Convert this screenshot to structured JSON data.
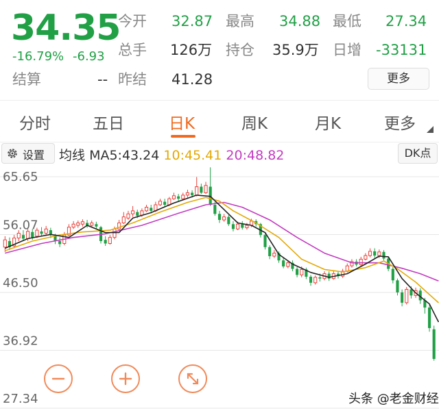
{
  "quote": {
    "price": "34.35",
    "change_pct": "-16.79%",
    "change_abs": "-6.93",
    "open_label": "今开",
    "open": "32.87",
    "high_label": "最高",
    "high": "34.88",
    "low_label": "最低",
    "low": "27.34",
    "volume_label": "总手",
    "volume": "126万",
    "position_label": "持仓",
    "position": "35.9万",
    "daily_inc_label": "日增",
    "daily_inc": "-33131",
    "settle_label": "结算",
    "settle": "--",
    "prev_settle_label": "昨结",
    "prev_settle": "41.28",
    "more_label": "更多"
  },
  "tabs": [
    {
      "label": "分时"
    },
    {
      "label": "五日"
    },
    {
      "label": "日K"
    },
    {
      "label": "周K"
    },
    {
      "label": "月K"
    },
    {
      "label": "更多"
    }
  ],
  "indicator": {
    "settings_label": "设置",
    "title": "均线",
    "ma5": "MA5:43.24",
    "ma10": "10:45.41",
    "ma20": "20:48.82",
    "dk_label": "DK点"
  },
  "colors": {
    "up": "#e8413a",
    "down": "#21a046",
    "ma5": "#222222",
    "ma10": "#e3a905",
    "ma20": "#c23bc0",
    "accent": "#ef6a1e"
  },
  "chart_data": {
    "type": "candlestick",
    "y_ticks": [
      "65.65",
      "56.07",
      "46.50",
      "36.92",
      "27.34"
    ],
    "ylim": [
      27.34,
      65.65
    ],
    "candles": [
      [
        54.0,
        55.2,
        53.2,
        55.8
      ],
      [
        55.0,
        54.0,
        53.5,
        55.6
      ],
      [
        54.2,
        55.5,
        53.8,
        56.0
      ],
      [
        55.5,
        56.3,
        55.0,
        56.8
      ],
      [
        56.0,
        55.4,
        55.0,
        56.8
      ],
      [
        55.4,
        56.6,
        55.0,
        57.0
      ],
      [
        56.5,
        55.6,
        55.2,
        57.0
      ],
      [
        55.8,
        56.8,
        55.5,
        57.2
      ],
      [
        56.6,
        56.2,
        55.8,
        57.3
      ],
      [
        56.3,
        57.0,
        56.0,
        57.5
      ],
      [
        56.8,
        56.0,
        55.5,
        57.2
      ],
      [
        55.8,
        55.0,
        54.5,
        56.2
      ],
      [
        55.0,
        54.5,
        54.0,
        55.6
      ],
      [
        54.6,
        56.0,
        54.3,
        56.5
      ],
      [
        56.0,
        57.3,
        55.8,
        57.8
      ],
      [
        57.3,
        57.8,
        57.0,
        58.3
      ],
      [
        57.6,
        58.0,
        57.2,
        58.4
      ],
      [
        57.8,
        58.2,
        57.4,
        58.6
      ],
      [
        58.0,
        57.6,
        57.2,
        58.5
      ],
      [
        57.6,
        58.0,
        57.3,
        58.4
      ],
      [
        57.8,
        57.4,
        57.0,
        58.2
      ],
      [
        57.3,
        55.0,
        54.6,
        57.5
      ],
      [
        55.2,
        54.6,
        54.2,
        55.8
      ],
      [
        54.6,
        55.6,
        54.4,
        56.0
      ],
      [
        55.6,
        57.0,
        55.3,
        57.4
      ],
      [
        57.0,
        58.0,
        56.8,
        58.5
      ],
      [
        58.0,
        59.0,
        57.8,
        59.8
      ],
      [
        58.8,
        59.5,
        58.5,
        60.0
      ],
      [
        59.5,
        60.0,
        59.0,
        60.8
      ],
      [
        59.8,
        59.2,
        58.8,
        60.2
      ],
      [
        59.3,
        60.0,
        59.0,
        60.4
      ],
      [
        60.0,
        60.6,
        59.8,
        61.0
      ],
      [
        60.5,
        60.0,
        59.6,
        61.0
      ],
      [
        60.0,
        61.0,
        59.8,
        61.5
      ],
      [
        61.0,
        61.6,
        60.8,
        62.0
      ],
      [
        61.5,
        61.0,
        60.6,
        62.0
      ],
      [
        61.0,
        62.0,
        60.8,
        62.3
      ],
      [
        62.0,
        62.5,
        61.8,
        63.0
      ],
      [
        62.4,
        62.0,
        61.6,
        62.8
      ],
      [
        62.0,
        62.6,
        61.8,
        63.0
      ],
      [
        62.6,
        63.0,
        62.2,
        63.5
      ],
      [
        63.0,
        62.6,
        62.2,
        63.4
      ],
      [
        62.6,
        64.0,
        62.4,
        65.6
      ],
      [
        64.0,
        63.0,
        62.8,
        64.5
      ],
      [
        63.0,
        64.2,
        62.8,
        64.8
      ],
      [
        64.0,
        61.0,
        60.8,
        67.2
      ],
      [
        61.0,
        59.5,
        59.2,
        61.5
      ],
      [
        59.5,
        58.5,
        58.0,
        60.0
      ],
      [
        58.5,
        59.0,
        58.2,
        59.5
      ],
      [
        59.0,
        57.8,
        57.5,
        59.3
      ],
      [
        57.8,
        57.0,
        56.6,
        58.3
      ],
      [
        57.0,
        57.8,
        56.8,
        58.2
      ],
      [
        57.8,
        57.2,
        56.9,
        58.3
      ],
      [
        57.2,
        57.6,
        56.9,
        58.0
      ],
      [
        57.6,
        58.3,
        57.3,
        58.7
      ],
      [
        58.3,
        57.8,
        57.4,
        58.6
      ],
      [
        57.8,
        56.0,
        55.6,
        58.0
      ],
      [
        56.0,
        54.0,
        53.6,
        56.2
      ],
      [
        54.0,
        52.5,
        52.0,
        54.3
      ],
      [
        52.5,
        53.0,
        52.2,
        53.5
      ],
      [
        53.0,
        51.8,
        51.4,
        53.3
      ],
      [
        51.8,
        50.8,
        50.5,
        52.2
      ],
      [
        50.8,
        51.4,
        50.5,
        51.8
      ],
      [
        51.4,
        50.4,
        50.0,
        51.8
      ],
      [
        50.4,
        49.4,
        49.0,
        50.7
      ],
      [
        49.4,
        50.3,
        49.0,
        50.8
      ],
      [
        50.3,
        49.1,
        48.7,
        50.6
      ],
      [
        49.1,
        48.1,
        47.6,
        49.4
      ],
      [
        48.1,
        49.0,
        47.8,
        49.3
      ],
      [
        49.0,
        48.8,
        48.3,
        49.6
      ],
      [
        48.8,
        49.6,
        48.5,
        50.0
      ],
      [
        49.6,
        48.8,
        48.4,
        50.0
      ],
      [
        48.8,
        49.6,
        48.6,
        50.0
      ],
      [
        49.6,
        49.2,
        48.8,
        50.0
      ],
      [
        49.2,
        50.0,
        48.9,
        50.4
      ],
      [
        50.0,
        50.9,
        49.8,
        51.3
      ],
      [
        50.9,
        51.6,
        50.6,
        52.0
      ],
      [
        51.6,
        51.1,
        50.8,
        52.0
      ],
      [
        51.1,
        52.0,
        50.8,
        52.4
      ],
      [
        52.0,
        52.6,
        51.8,
        53.0
      ],
      [
        52.6,
        53.3,
        52.3,
        53.8
      ],
      [
        53.3,
        52.6,
        52.2,
        53.8
      ],
      [
        52.6,
        53.2,
        52.2,
        53.6
      ],
      [
        53.2,
        52.1,
        51.8,
        53.5
      ],
      [
        52.1,
        50.4,
        50.0,
        52.4
      ],
      [
        50.4,
        48.5,
        48.0,
        50.7
      ],
      [
        48.5,
        46.5,
        46.0,
        48.8
      ],
      [
        46.5,
        44.8,
        44.2,
        47.0
      ],
      [
        44.8,
        47.0,
        44.5,
        47.4
      ],
      [
        47.0,
        46.0,
        45.5,
        47.5
      ],
      [
        46.0,
        46.8,
        45.6,
        47.3
      ],
      [
        46.8,
        45.2,
        44.6,
        47.2
      ],
      [
        45.2,
        44.0,
        43.0,
        45.6
      ],
      [
        44.0,
        40.6,
        40.0,
        44.4
      ],
      [
        40.4,
        35.5,
        35.2,
        41.0
      ]
    ],
    "ma5": [
      [
        0,
        53.8
      ],
      [
        5,
        55.4
      ],
      [
        10,
        56.1
      ],
      [
        14,
        55.6
      ],
      [
        18,
        57.6
      ],
      [
        22,
        56.4
      ],
      [
        25,
        56.4
      ],
      [
        28,
        58.8
      ],
      [
        32,
        59.7
      ],
      [
        37,
        61.3
      ],
      [
        42,
        62.6
      ],
      [
        45,
        62.4
      ],
      [
        48,
        60.2
      ],
      [
        51,
        58.0
      ],
      [
        54,
        57.6
      ],
      [
        57,
        56.4
      ],
      [
        60,
        52.8
      ],
      [
        63,
        51.2
      ],
      [
        67,
        49.8
      ],
      [
        71,
        49.0
      ],
      [
        75,
        49.6
      ],
      [
        79,
        51.2
      ],
      [
        82,
        52.5
      ],
      [
        84,
        52.4
      ],
      [
        87,
        48.8
      ],
      [
        90,
        46.4
      ],
      [
        93,
        44.6
      ],
      [
        95,
        41.6
      ]
    ],
    "ma10": [
      [
        0,
        53.4
      ],
      [
        6,
        55.0
      ],
      [
        12,
        56.0
      ],
      [
        17,
        56.5
      ],
      [
        23,
        56.8
      ],
      [
        28,
        58.0
      ],
      [
        34,
        59.8
      ],
      [
        40,
        61.4
      ],
      [
        44,
        62.2
      ],
      [
        47,
        61.6
      ],
      [
        50,
        60.0
      ],
      [
        55,
        58.0
      ],
      [
        60,
        55.6
      ],
      [
        65,
        52.0
      ],
      [
        70,
        50.3
      ],
      [
        74,
        49.9
      ],
      [
        79,
        50.6
      ],
      [
        83,
        51.7
      ],
      [
        86,
        50.4
      ],
      [
        90,
        48.2
      ],
      [
        95,
        44.8
      ]
    ],
    "ma20": [
      [
        0,
        53.0
      ],
      [
        8,
        54.6
      ],
      [
        15,
        55.6
      ],
      [
        22,
        56.2
      ],
      [
        30,
        57.6
      ],
      [
        38,
        59.6
      ],
      [
        44,
        61.0
      ],
      [
        48,
        61.4
      ],
      [
        52,
        60.6
      ],
      [
        58,
        58.5
      ],
      [
        64,
        55.6
      ],
      [
        70,
        53.0
      ],
      [
        76,
        51.4
      ],
      [
        82,
        51.4
      ],
      [
        87,
        50.5
      ],
      [
        91,
        49.6
      ],
      [
        95,
        48.4
      ]
    ]
  },
  "watermark": "头条 @老金财经"
}
